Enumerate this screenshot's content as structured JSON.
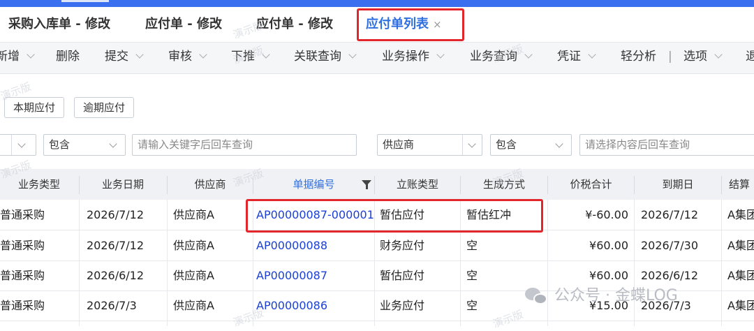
{
  "tabs": [
    {
      "label": "采购入库单 - 修改",
      "active": false
    },
    {
      "label": "应付单 - 修改",
      "active": false
    },
    {
      "label": "应付单 - 修改",
      "active": false
    },
    {
      "label": "应付单列表",
      "active": true,
      "close": "×"
    }
  ],
  "toolbar": [
    "新增",
    "删除",
    "提交",
    "审核",
    "下推",
    "关联查询",
    "业务操作",
    "业务查询",
    "凭证",
    "轻分析",
    "选项",
    "退"
  ],
  "toolbar_separator": "|",
  "quick_filters": [
    "本期应付",
    "逾期应付"
  ],
  "filter_row": {
    "condition1": "包含",
    "keyword_placeholder": "请输入关键字后回车查询",
    "field2": "供应商",
    "condition2": "包含",
    "value_placeholder": "请选择内容后回车查询"
  },
  "columns": [
    "业务类型",
    "业务日期",
    "供应商",
    "单据编号",
    "立账类型",
    "生成方式",
    "价税合计",
    "到期日",
    "结算"
  ],
  "rows": [
    [
      "普通采购",
      "2026/7/12",
      "供应商A",
      "AP00000087-000001",
      "暂估应付",
      "暂估红冲",
      "¥-60.00",
      "2026/7/12",
      "A集团"
    ],
    [
      "普通采购",
      "2026/7/12",
      "供应商A",
      "AP00000088",
      "财务应付",
      "空",
      "¥60.00",
      "2026/7/30",
      "A集团"
    ],
    [
      "普通采购",
      "2026/6/12",
      "供应商A",
      "AP00000087",
      "暂估应付",
      "空",
      "¥60.00",
      "2026/6/12",
      "A集团"
    ],
    [
      "普通采购",
      "2026/7/3",
      "供应商A",
      "AP00000086",
      "业务应付",
      "空",
      "¥15.00",
      "2026/7/3",
      "A集团"
    ]
  ],
  "watermark_text": "演示版",
  "wechat_text": "公众号 · 金蝶LOG",
  "colors": {
    "accent": "#2f6fe0",
    "link": "#1a3fd6",
    "highlight": "#e3262b"
  }
}
